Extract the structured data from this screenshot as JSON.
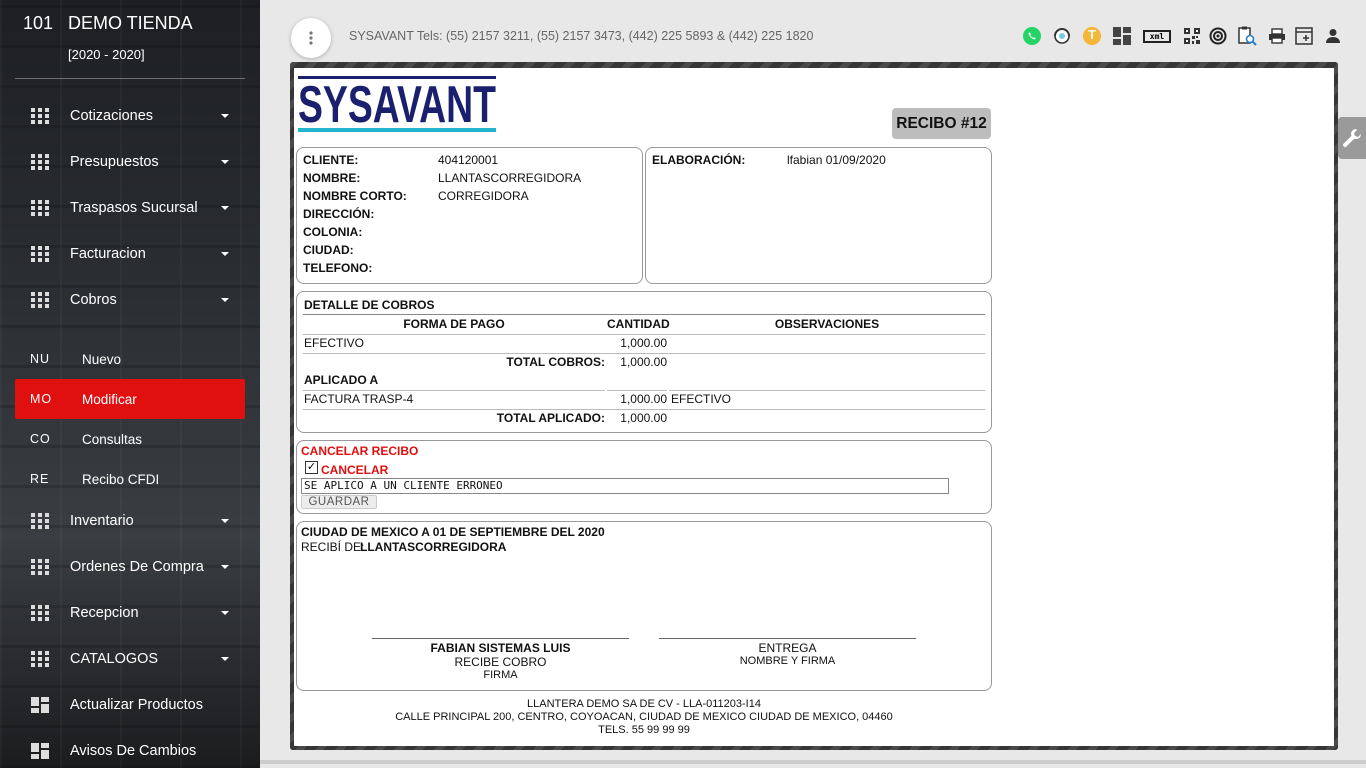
{
  "store": {
    "number": "101",
    "name": "DEMO TIENDA",
    "period": "[2020 - 2020]"
  },
  "sidebar": {
    "items": [
      {
        "label": "Cotizaciones"
      },
      {
        "label": "Presupuestos"
      },
      {
        "label": "Traspasos Sucursal"
      },
      {
        "label": "Facturacion"
      },
      {
        "label": "Cobros"
      }
    ],
    "subitems": [
      {
        "abbr": "NU",
        "label": "Nuevo"
      },
      {
        "abbr": "MO",
        "label": "Modificar"
      },
      {
        "abbr": "CO",
        "label": "Consultas"
      },
      {
        "abbr": "RE",
        "label": "Recibo CFDI"
      }
    ],
    "items2": [
      {
        "label": "Inventario"
      },
      {
        "label": "Ordenes De Compra"
      },
      {
        "label": "Recepcion"
      },
      {
        "label": "CATALOGOS"
      },
      {
        "label": "Actualizar Productos"
      },
      {
        "label": "Avisos De Cambios"
      }
    ]
  },
  "topbar": {
    "contact": "SYSAVANT Tels: (55) 2157 3211, (55) 2157 3473, (442) 225 5893 & (442) 225 1820",
    "user_initial": "T",
    "xml_label": "xml",
    "icons": [
      "whatsapp-icon",
      "support-icon",
      "user-initial-icon",
      "dashboard-icon",
      "xml-icon",
      "qr-icon",
      "target-icon",
      "report-search-icon",
      "print-icon",
      "new-window-icon",
      "person-icon"
    ]
  },
  "receipt": {
    "logo_text": "SYSAVANT",
    "badge": "RECIBO #12",
    "client": {
      "cliente_label": "CLIENTE:",
      "cliente": "404120001",
      "nombre_label": "NOMBRE:",
      "nombre": "LLANTASCORREGIDORA",
      "corto_label": "NOMBRE CORTO:",
      "corto": "CORREGIDORA",
      "direccion_label": "DIRECCIÓN:",
      "colonia_label": "COLONIA:",
      "ciudad_label": "CIUDAD:",
      "telefono_label": "TELEFONO:"
    },
    "elaboracion_label": "ELABORACIÓN:",
    "elaboracion": "lfabian 01/09/2020",
    "detalle": {
      "title": "DETALLE DE COBROS",
      "col_forma": "FORMA DE PAGO",
      "col_cantidad": "CANTIDAD",
      "col_obs": "OBSERVACIONES",
      "row_forma": "EFECTIVO",
      "row_cantidad": "1,000.00",
      "total_cobros_label": "TOTAL COBROS:",
      "total_cobros": "1,000.00",
      "aplicado_title": "APLICADO A",
      "apl_doc": "FACTURA TRASP-4",
      "apl_cantidad": "1,000.00",
      "apl_obs": "EFECTIVO",
      "total_aplicado_label": "TOTAL APLICADO:",
      "total_aplicado": "1,000.00"
    },
    "cancel": {
      "title": "CANCELAR RECIBO",
      "checkbox_label": "CANCELAR",
      "reason": "SE APLICO A UN CLIENTE ERRONEO",
      "save": "GUARDAR"
    },
    "footer_block": {
      "place_date": "CIUDAD DE MEXICO A 01 DE SEPTIEMBRE DEL 2020",
      "received_from_label": "RECIBÍ DE:",
      "received_from": "LLANTASCORREGIDORA",
      "sig1_name": "FABIAN SISTEMAS LUIS",
      "sig1_role": "RECIBE COBRO",
      "sig1_firma": "FIRMA",
      "sig2_name": "ENTREGA",
      "sig2_role": "NOMBRE Y FIRMA"
    },
    "company": {
      "line1": "LLANTERA DEMO SA DE CV - LLA-011203-I14",
      "line2": "CALLE PRINCIPAL 200, CENTRO, COYOACAN, CIUDAD DE MEXICO CIUDAD DE MEXICO, 04460",
      "line3": "TELS. 55 99 99 99"
    }
  },
  "colors": {
    "accent": "#e01010",
    "logo_blue": "#1a1f6e",
    "logo_cyan": "#22b5cf"
  }
}
